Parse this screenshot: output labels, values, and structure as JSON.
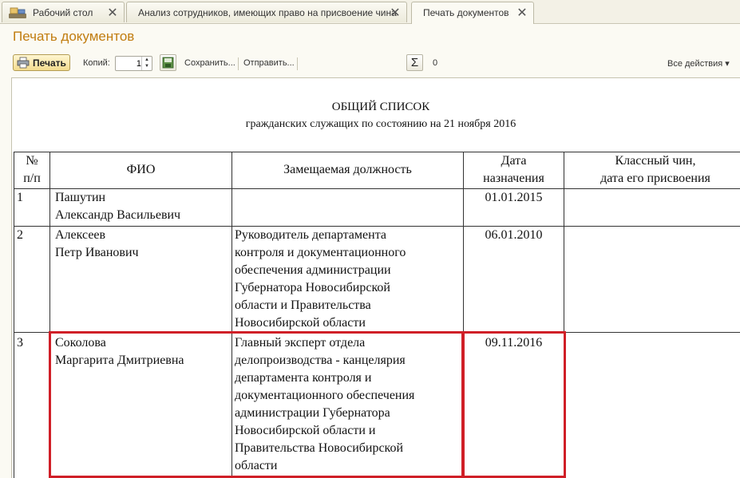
{
  "tabs": [
    {
      "label": "Рабочий стол",
      "close": "✕"
    },
    {
      "label": "Анализ сотрудников, имеющих право на присвоение чина",
      "close": "✕"
    },
    {
      "label": "Печать документов",
      "close": "✕"
    }
  ],
  "page_title": "Печать документов",
  "toolbar": {
    "print_label": "Печать",
    "copies_label": "Копий:",
    "copies_value": "1",
    "save_label": "Сохранить...",
    "send_label": "Отправить...",
    "sum_symbol": "Σ",
    "sum_value": "0",
    "all_actions_label": "Все действия ▾"
  },
  "document": {
    "heading": "ОБЩИЙ СПИСОК",
    "subheading": "гражданских служащих по состоянию на 21 ноября 2016",
    "columns": [
      {
        "lines": [
          "№",
          "п/п"
        ]
      },
      {
        "lines": [
          "ФИО"
        ]
      },
      {
        "lines": [
          "Замещаемая должность"
        ]
      },
      {
        "lines": [
          "Дата",
          "назначения"
        ]
      },
      {
        "lines": [
          "Классный чин,",
          "дата его присвоения"
        ]
      }
    ],
    "rows": [
      {
        "num": "1",
        "fio": [
          "Пашутин",
          "Александр Васильевич"
        ],
        "position": [],
        "date": "01.01.2015",
        "rank": ""
      },
      {
        "num": "2",
        "fio": [
          "Алексеев",
          "Петр Иванович"
        ],
        "position": [
          "Руководитель департамента",
          "контроля и документационного",
          "обеспечения администрации",
          "Губернатора Новосибирской",
          "области и Правительства",
          "Новосибирской области"
        ],
        "date": "06.01.2010",
        "rank": ""
      },
      {
        "num": "3",
        "fio": [
          "Соколова",
          "Маргарита Дмитриевна"
        ],
        "position": [
          "Главный эксперт отдела",
          "делопроизводства - канцелярия",
          "департамента контроля и",
          "документационного обеспечения",
          "администрации Губернатора",
          "Новосибирской области и",
          "Правительства Новосибирской",
          "области"
        ],
        "date": "09.11.2016",
        "rank": ""
      }
    ]
  },
  "colors": {
    "title": "#c17d10",
    "highlight": "#d01f27",
    "background": "#fbfaf3"
  },
  "icons": [
    "home-desk-icon",
    "printer-icon",
    "spin-arrows-icon",
    "save-settings-icon",
    "sigma-icon",
    "tab-close-icon"
  ]
}
